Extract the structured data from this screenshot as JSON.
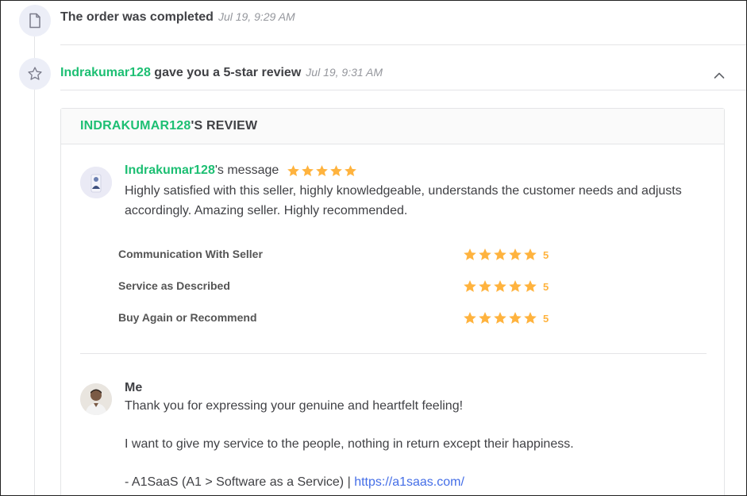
{
  "events": {
    "completed": {
      "icon": "document-icon",
      "title": "The order was completed",
      "time": "Jul 19, 9:29 AM"
    },
    "review": {
      "icon": "star-outline-icon",
      "username": "Indrakumar128",
      "title_rest": " gave you a 5-star review",
      "time": "Jul 19, 9:31 AM"
    }
  },
  "review_card": {
    "header_user": "INDRAKUMAR128",
    "header_rest": "'S REVIEW",
    "message": {
      "username": "Indrakumar128",
      "suffix": "'s message",
      "stars": 5,
      "text": "Highly satisfied with this seller, highly knowledgeable, understands the customer needs and adjusts accordingly. Amazing seller. Highly recommended."
    },
    "ratings": [
      {
        "label": "Communication With Seller",
        "stars": 5,
        "value": "5"
      },
      {
        "label": "Service as Described",
        "stars": 5,
        "value": "5"
      },
      {
        "label": "Buy Again or Recommend",
        "stars": 5,
        "value": "5"
      }
    ],
    "reply": {
      "name": "Me",
      "line1": "Thank you for expressing your genuine and heartfelt feeling!",
      "line2": "I want to give my service to the people, nothing in return except their happiness.",
      "line3_prefix": "- A1SaaS (A1 > Software as a Service) | ",
      "link": "https://a1saas.com/"
    }
  },
  "colors": {
    "accent": "#1dbf73",
    "star": "#ffb33e",
    "link": "#446ee7",
    "text": "#404145",
    "muted": "#95979d"
  }
}
